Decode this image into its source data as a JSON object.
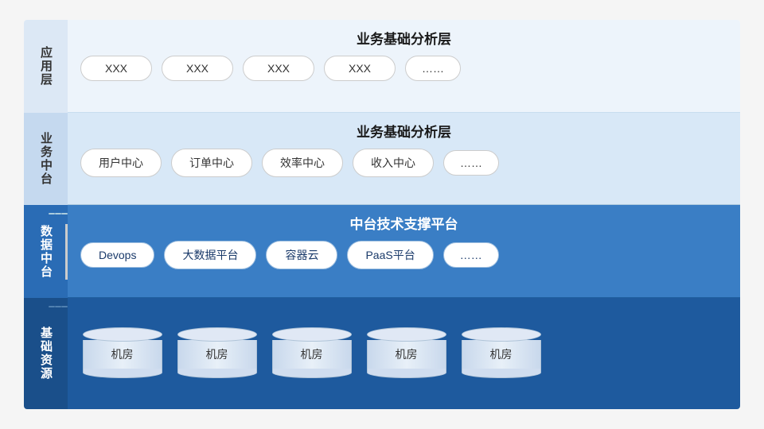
{
  "diagram": {
    "layers": [
      {
        "id": "app",
        "label": "应\n用\n层",
        "labelChars": [
          "应",
          "用",
          "层"
        ],
        "title": "业务基础分析层",
        "cards": [
          "XXX",
          "XXX",
          "XXX",
          "XXX"
        ],
        "ellipsis": "……"
      },
      {
        "id": "biz",
        "label": "业\n务\n中\n台",
        "labelChars": [
          "业",
          "务",
          "中",
          "台"
        ],
        "title": "业务基础分析层",
        "cards": [
          "用户中心",
          "订单中心",
          "效率中心",
          "收入中心"
        ],
        "ellipsis": "……"
      },
      {
        "id": "data",
        "label": "数\n据\n中\n台",
        "labelChars": [
          "数",
          "据",
          "中",
          "台"
        ],
        "title": "中台技术支撑平台",
        "cards": [
          "Devops",
          "大数据平台",
          "容器云",
          "PaaS平台"
        ],
        "ellipsis": "……"
      },
      {
        "id": "infra",
        "label": "基\n础\n资\n源",
        "labelChars": [
          "基",
          "础",
          "资",
          "源"
        ],
        "title": "",
        "cylinders": [
          "机房",
          "机房",
          "机房",
          "机房",
          "机房"
        ]
      }
    ]
  }
}
